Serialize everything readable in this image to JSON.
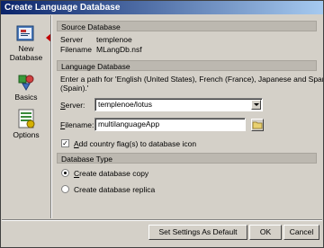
{
  "window": {
    "title": "Create Language Database"
  },
  "sidebar": {
    "items": [
      {
        "label": "New Database",
        "label_line1": "New",
        "label_line2": "Database"
      },
      {
        "label": "Basics"
      },
      {
        "label": "Options"
      }
    ]
  },
  "source": {
    "heading": "Source Database",
    "server_label": "Server",
    "server_value": "templenoe",
    "filename_label": "Filename",
    "filename_value": "MLangDb.nsf"
  },
  "language": {
    "heading": "Language Database",
    "instructions": "Enter a path for 'English (United States), French (France), Japanese and Spanish (Spain).'",
    "instructions_line1": "Enter a path for 'English (United States), French (France), Japanese and Spanish",
    "instructions_line2": "(Spain).'",
    "server_label": "Server:",
    "server_label_mnemonic": "S",
    "server_label_rest": "erver:",
    "server_value": "templenoe/lotus",
    "filename_label": "Filename:",
    "filename_label_mnemonic": "F",
    "filename_label_rest": "ilename:",
    "filename_value": "multilanguageApp",
    "flag_checkbox_label": "Add country flag(s) to database icon",
    "flag_checkbox_mnemonic": "A",
    "flag_checkbox_rest": "dd country flag(s) to database icon",
    "flag_checked": true
  },
  "dbtype": {
    "heading": "Database Type",
    "options": [
      {
        "label": "Create database copy",
        "mnemonic": "C",
        "rest": "reate database copy",
        "selected": true
      },
      {
        "label": "Create database replica",
        "mnemonic": "",
        "rest": "Create database replica",
        "selected": false
      }
    ]
  },
  "buttons": {
    "defaults": "Set Settings As Default",
    "ok": "OK",
    "cancel": "Cancel"
  }
}
